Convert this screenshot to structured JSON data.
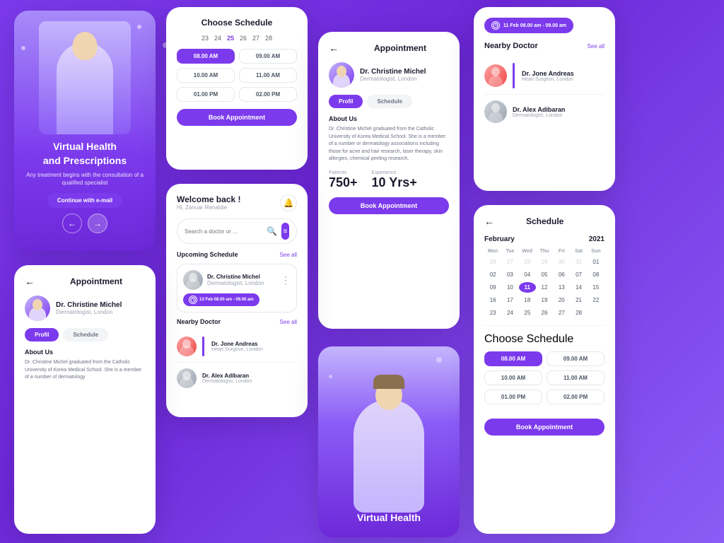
{
  "hero": {
    "title": "Virtual Health",
    "title2": "and Prescriptions",
    "subtitle": "Any treatment begins with the consultation of a qualified specialist",
    "cta_btn": "Continue with e-mail",
    "nav_prev": "←",
    "nav_next": "→"
  },
  "schedule_top": {
    "title": "Choose Schedule",
    "dates": [
      "23",
      "24",
      "25",
      "26",
      "27",
      "28"
    ],
    "active_date": "25",
    "times": [
      "08.00 AM",
      "09.00 AM",
      "10.00 AM",
      "11.00 AM",
      "01.00 PM",
      "02.00 PM"
    ],
    "active_time": "08.00 AM",
    "book_btn": "Book Appointment"
  },
  "appointment_top": {
    "back": "←",
    "title": "Appointment",
    "doctor_name": "Dr. Christine Michel",
    "doctor_spec": "Dermatologist, London",
    "tab_profil": "Profil",
    "tab_schedule": "Schedule",
    "about_title": "About Us",
    "about_text": "Dr. Christine Michel graduated from the Catholic University of Korea Medical School. She is a member of a number or dermatology associations including those for acne and hair research, laser therapy, skin allergies, chemical peeling research.",
    "patients_label": "Patients",
    "patients_value": "750+",
    "experience_label": "Experience",
    "experience_value": "10 Yrs+",
    "book_btn": "Book Appointment"
  },
  "nearby_top": {
    "time_badge": "11 Feb 08.00 am - 09.00 am",
    "title": "Nearby Doctor",
    "see_all": "See all",
    "doctors": [
      {
        "name": "Dr. Jone Andreas",
        "spec": "Heart Surgeon, London",
        "avatar_color": "red"
      },
      {
        "name": "Dr. Alex Adibaran",
        "spec": "Dermatologist, London",
        "avatar_color": "gray"
      }
    ]
  },
  "welcome": {
    "greeting": "Welcome back !",
    "username": "Hi, Zanuar Renaldie",
    "search_placeholder": "Search a doctor or ...",
    "upcoming_title": "Upcoming Schedule",
    "see_all": "See all",
    "schedule_doc_name": "Dr. Christine Michel",
    "schedule_doc_spec": "Dermatologist, London",
    "schedule_time": "13 Feb 08.00 am - 09.00 am",
    "nearby_title": "Nearby Doctor",
    "nearby_see_all": "See all",
    "nearby_docs": [
      {
        "name": "Dr. Jone Andreas",
        "spec": "Heart Surgeon, London",
        "avatar_color": "red"
      },
      {
        "name": "Dr. Alex Adibaran",
        "spec": "Dermatologist, London",
        "avatar_color": "gray"
      }
    ]
  },
  "appointment_bottom": {
    "back": "←",
    "title": "Appointment",
    "doctor_name": "Dr. Christine Michel",
    "doctor_spec": "Dermatologist, London",
    "tab_profil": "Profil",
    "tab_schedule": "Schedule",
    "about_title": "About Us",
    "about_text": "Dr. Christine Michel graduated from the Catholic University of Korea Medical School. She is a member of a number of dermatology"
  },
  "vhealth_bottom": {
    "title": "Virtual Health"
  },
  "calendar": {
    "back": "←",
    "title": "Schedule",
    "month": "February",
    "year": "2021",
    "day_labels": [
      "Mon",
      "Tue",
      "Wed",
      "Thu",
      "Fri",
      "Sat",
      "Sun"
    ],
    "weeks": [
      [
        "26",
        "27",
        "28",
        "29",
        "30",
        "31",
        "01"
      ],
      [
        "02",
        "03",
        "04",
        "05",
        "06",
        "07",
        "08"
      ],
      [
        "09",
        "10",
        "11",
        "12",
        "13",
        "14",
        "15"
      ],
      [
        "16",
        "17",
        "18",
        "19",
        "20",
        "21",
        "22"
      ],
      [
        "23",
        "24",
        "25",
        "26",
        "27",
        "28",
        ""
      ]
    ],
    "today": "11",
    "other_month_start": [
      "26",
      "27",
      "28",
      "29",
      "30",
      "31"
    ],
    "schedule_title": "Choose Schedule",
    "times": [
      "08.00 AM",
      "09.00 AM",
      "10.00 AM",
      "11.00 AM",
      "01.00 PM",
      "02.00 PM"
    ],
    "active_time": "08.00 AM",
    "book_btn": "Book Appointment"
  }
}
